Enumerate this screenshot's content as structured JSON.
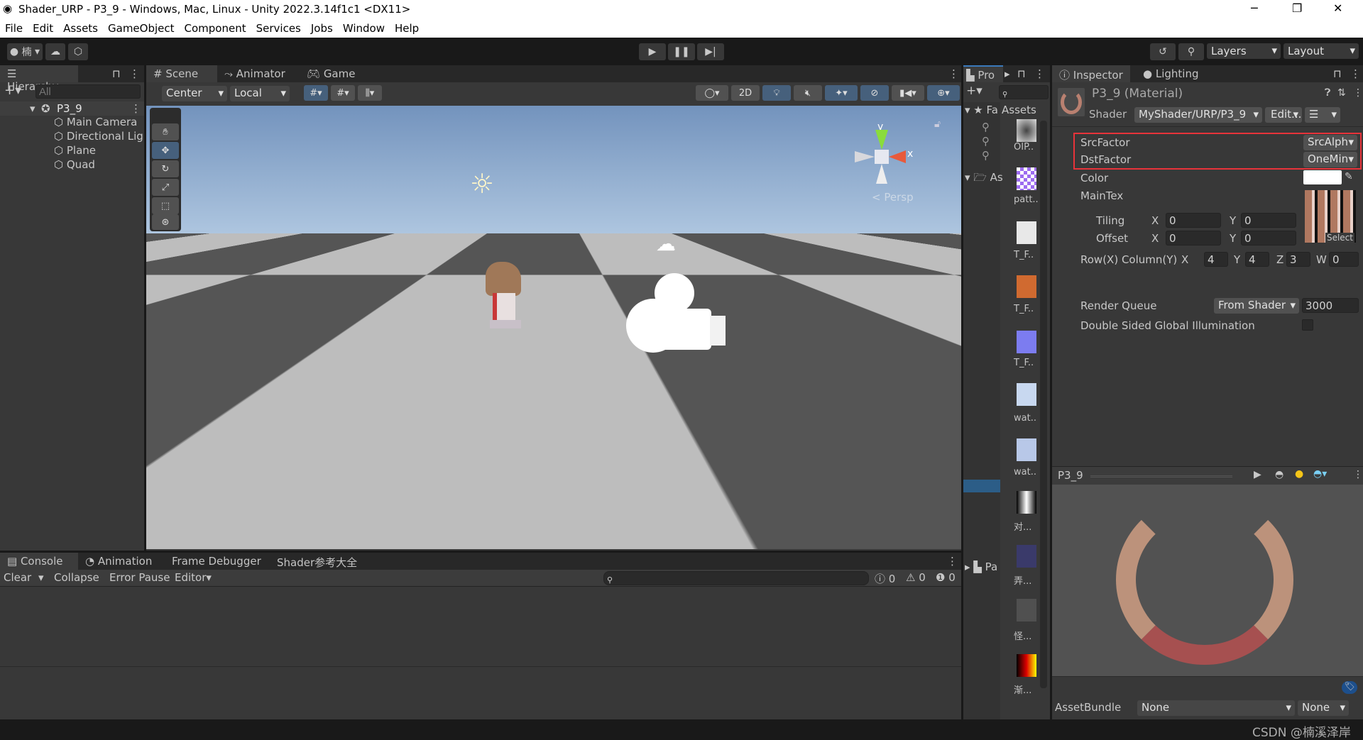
{
  "window": {
    "title": "Shader_URP - P3_9 - Windows, Mac, Linux - Unity 2022.3.14f1c1 <DX11>",
    "minimize": "─",
    "maximize": "❐",
    "close": "✕"
  },
  "menu": [
    "File",
    "Edit",
    "Assets",
    "GameObject",
    "Component",
    "Services",
    "Jobs",
    "Window",
    "Help"
  ],
  "toolbar": {
    "account": "楠",
    "layers": "Layers",
    "layout": "Layout"
  },
  "hierarchy": {
    "tab": "Hierarchy",
    "search_placeholder": "All",
    "scene": "P3_9",
    "items": [
      "Main Camera",
      "Directional Lig",
      "Plane",
      "Quad"
    ]
  },
  "scene": {
    "tabs": [
      "Scene",
      "Animator",
      "Game"
    ],
    "pivot": "Center",
    "space": "Local",
    "mode_2d": "2D",
    "gizmo_y": "y",
    "gizmo_x": "x",
    "persp": "Persp"
  },
  "console": {
    "tabs": [
      "Console",
      "Animation",
      "Frame Debugger",
      "Shader参考大全"
    ],
    "clear": "Clear",
    "collapse": "Collapse",
    "error_pause": "Error Pause",
    "editor": "Editor",
    "counts": {
      "errors": "0",
      "warnings": "0",
      "messages": "0"
    }
  },
  "project": {
    "tab": "Pro",
    "tree": [
      "Fa",
      "As",
      "Pa"
    ],
    "assets_label": "Assets",
    "thumbs": [
      "OIP..",
      "patt..",
      "T_F..",
      "T_F..",
      "T_F..",
      "wat..",
      "wat..",
      "对...",
      "弄...",
      "怪...",
      "渐..."
    ]
  },
  "inspector": {
    "tabs": [
      "Inspector",
      "Lighting"
    ],
    "material": "P3_9 (Material)",
    "shader_label": "Shader",
    "shader": "MyShader/URP/P3_9",
    "edit": "Edit...",
    "props": {
      "src_label": "SrcFactor",
      "src": "SrcAlph",
      "dst_label": "DstFactor",
      "dst": "OneMin",
      "color_label": "Color",
      "color": "#ffffff",
      "maintex_label": "MainTex",
      "tiling_label": "Tiling",
      "offset_label": "Offset",
      "x": "X",
      "y": "Y",
      "z": "Z",
      "w": "W",
      "tiling_x": "0",
      "tiling_y": "0",
      "offset_x": "0",
      "offset_y": "0",
      "select": "Select",
      "rowcol_label": "Row(X) Column(Y) S|",
      "rc_x": "4",
      "rc_y": "4",
      "rc_z": "3",
      "rc_w": "0",
      "rq_label": "Render Queue",
      "rq_mode": "From Shader",
      "rq_value": "3000",
      "dsgi_label": "Double Sided Global Illumination"
    },
    "preview_title": "P3_9",
    "assetbundle_label": "AssetBundle",
    "assetbundle": "None",
    "variant": "None"
  },
  "watermark": "CSDN @楠溪泽岸",
  "colors": {
    "highlight": "#e8333a",
    "active_button": "#46607c",
    "sky_top": "#7393bd",
    "sky_bottom": "#b4cbe3"
  }
}
